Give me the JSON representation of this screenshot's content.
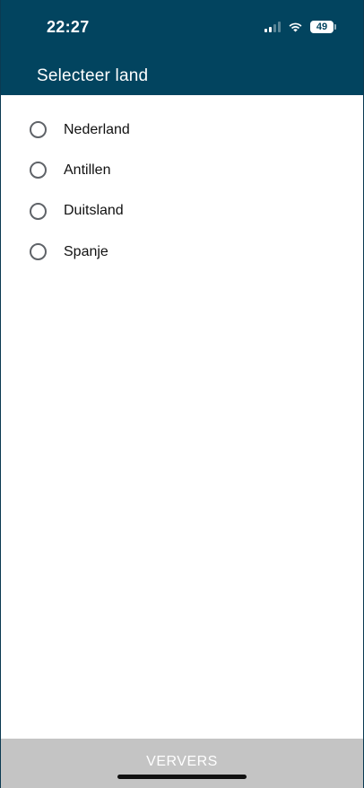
{
  "status_bar": {
    "time": "22:27",
    "battery": "49",
    "icons": [
      "signal-icon",
      "wifi-icon",
      "battery-icon"
    ]
  },
  "header": {
    "title": "Selecteer land"
  },
  "countries": [
    {
      "label": "Nederland",
      "selected": false
    },
    {
      "label": "Antillen",
      "selected": false
    },
    {
      "label": "Duitsland",
      "selected": false
    },
    {
      "label": "Spanje",
      "selected": false
    }
  ],
  "footer": {
    "refresh_label": "VERVERS"
  },
  "colors": {
    "header_bg": "#02445f",
    "footer_bg": "#c4c4c4",
    "radio_border": "#5f6368"
  }
}
